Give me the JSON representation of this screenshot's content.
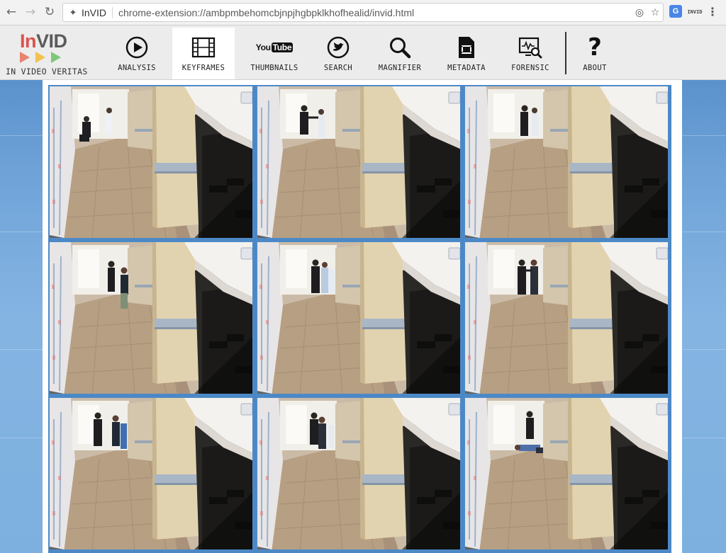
{
  "browser": {
    "back_icon": "arrow-left-icon",
    "forward_icon": "arrow-right-icon",
    "reload_icon": "reload-icon",
    "site_name": "InVID",
    "url": "chrome-extension://ambpmbehomcbjnpjhgbpklkhofhealid/invid.html",
    "ext_badge": "INVID"
  },
  "header": {
    "logo_in": "In",
    "logo_vid": "VID",
    "logo_caption": "IN VIDEO VERITAS",
    "logo_colors": [
      "#e8836f",
      "#f2c14e",
      "#7ec77a"
    ],
    "youtube_badge": "You",
    "youtube_badge_tube": "Tube",
    "tabs": [
      {
        "label": "ANALYSIS",
        "icon": "play-circle-icon",
        "active": false
      },
      {
        "label": "KEYFRAMES",
        "icon": "film-strip-icon",
        "active": true
      },
      {
        "label": "THUMBNAILS",
        "icon": "youtube-icon",
        "active": false
      },
      {
        "label": "SEARCH",
        "icon": "twitter-icon",
        "active": false
      },
      {
        "label": "MAGNIFIER",
        "icon": "magnifier-icon",
        "active": false
      },
      {
        "label": "METADATA",
        "icon": "film-document-icon",
        "active": false
      },
      {
        "label": "FORENSIC",
        "icon": "monitor-search-icon",
        "active": false
      },
      {
        "label": "ABOUT",
        "icon": "question-mark-icon",
        "active": false
      }
    ]
  },
  "keyframes": {
    "count": 9,
    "description_shown": "CCTV hallway keyframes"
  }
}
